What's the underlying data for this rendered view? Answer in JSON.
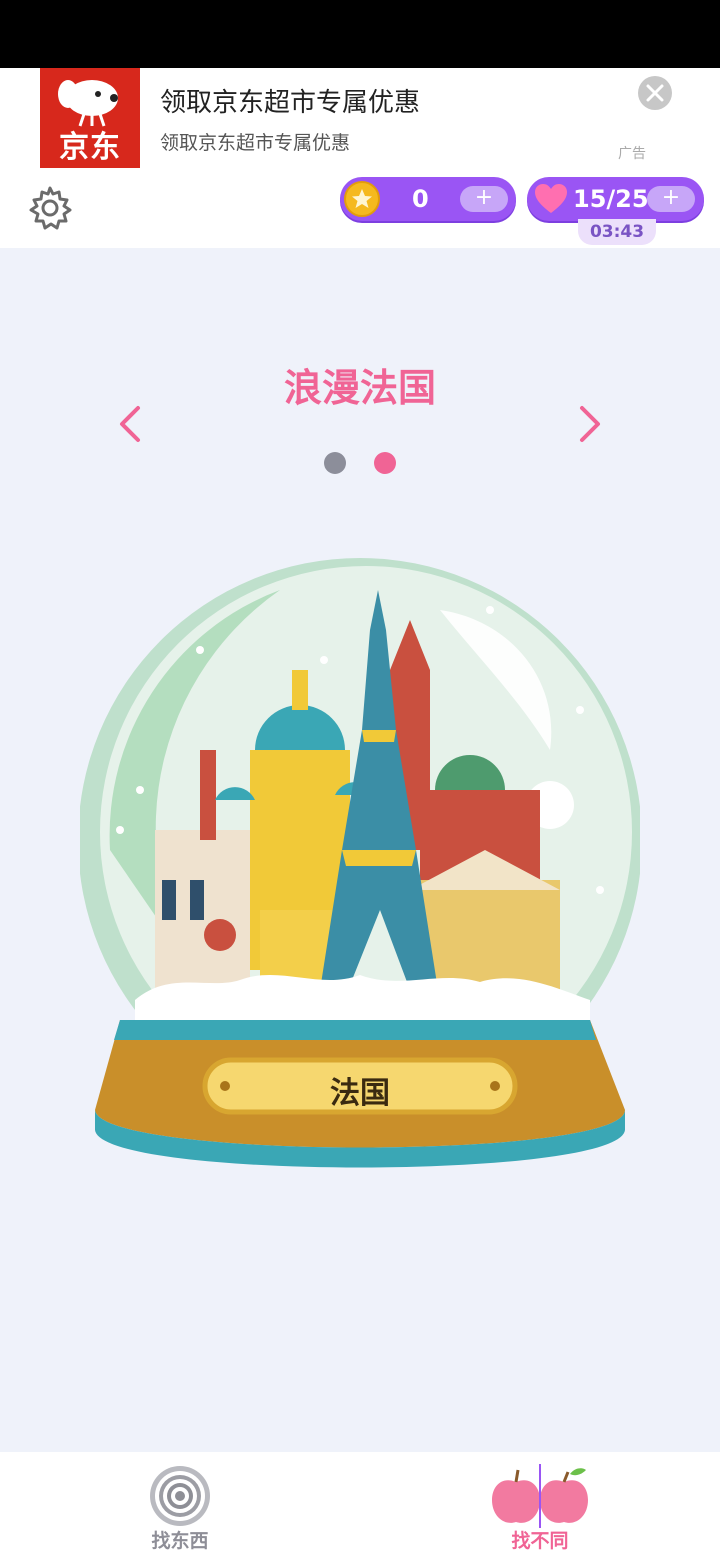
{
  "ad": {
    "logo_text": "京东",
    "title": "领取京东超市专属优惠",
    "subtitle": "领取京东超市专属优惠",
    "ad_label": "广告"
  },
  "topbar": {
    "coins": "0",
    "coins_plus": "+",
    "lives": "15/25",
    "lives_plus": "+",
    "timer": "03:43"
  },
  "level": {
    "title": "浪漫法国",
    "plaque": "法国",
    "page_index": 2,
    "page_count": 2
  },
  "nav": {
    "find_label": "找东西",
    "diff_label": "找不同"
  },
  "colors": {
    "accent_pink": "#f06495",
    "pill_purple": "#9a55f4",
    "background": "#eff2fa"
  },
  "icons": {
    "settings": "gear-icon",
    "coin": "star-coin-icon",
    "lives": "heart-icon",
    "prev": "chevron-left-icon",
    "next": "chevron-right-icon",
    "find": "target-icon",
    "diff": "apples-icon"
  }
}
